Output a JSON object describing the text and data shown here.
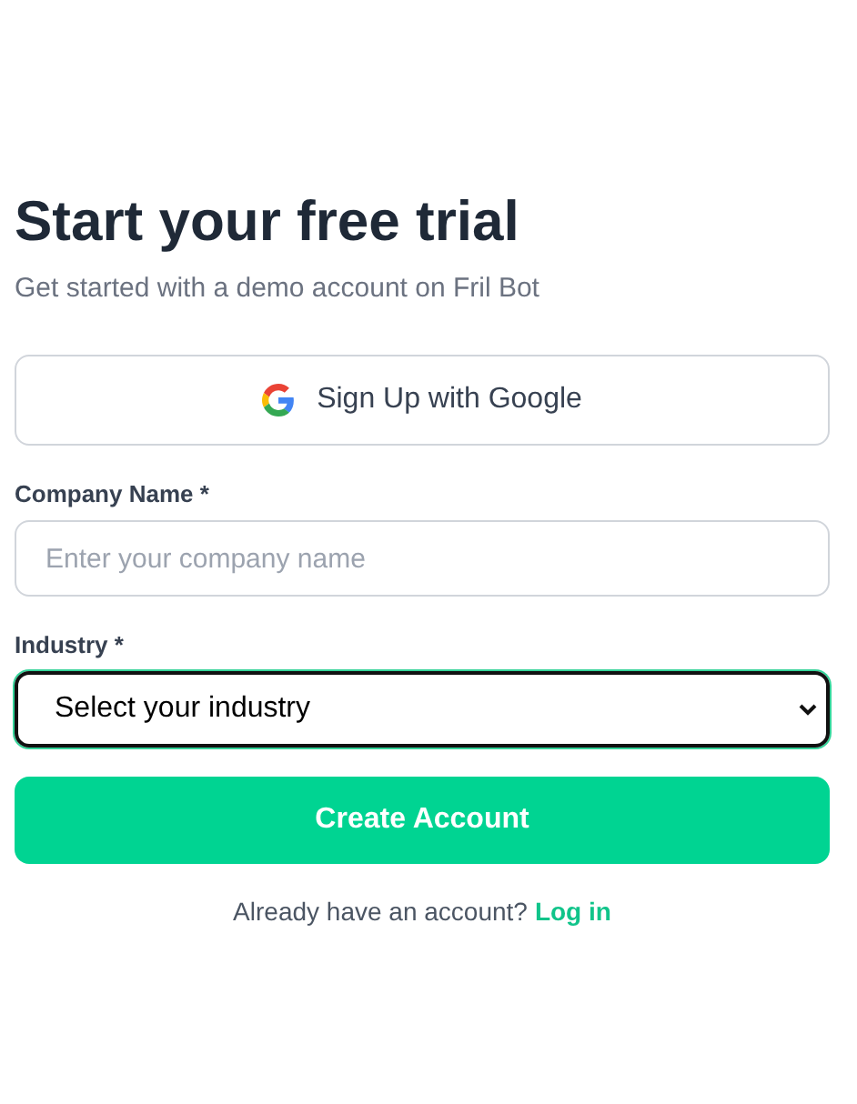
{
  "title": "Start your free trial",
  "subtitle": "Get started with a demo account on Fril Bot",
  "google_button": {
    "label": "Sign Up with Google"
  },
  "fields": [
    {
      "kind": "input",
      "label": "Company Name *",
      "placeholder": "Enter your company name"
    },
    {
      "kind": "select",
      "label": "Industry *",
      "value": "Select your industry",
      "focused": true
    }
  ],
  "submit_button": {
    "label": "Create Account"
  },
  "footer": {
    "text": "Already have an account?",
    "link": "Log in"
  }
}
